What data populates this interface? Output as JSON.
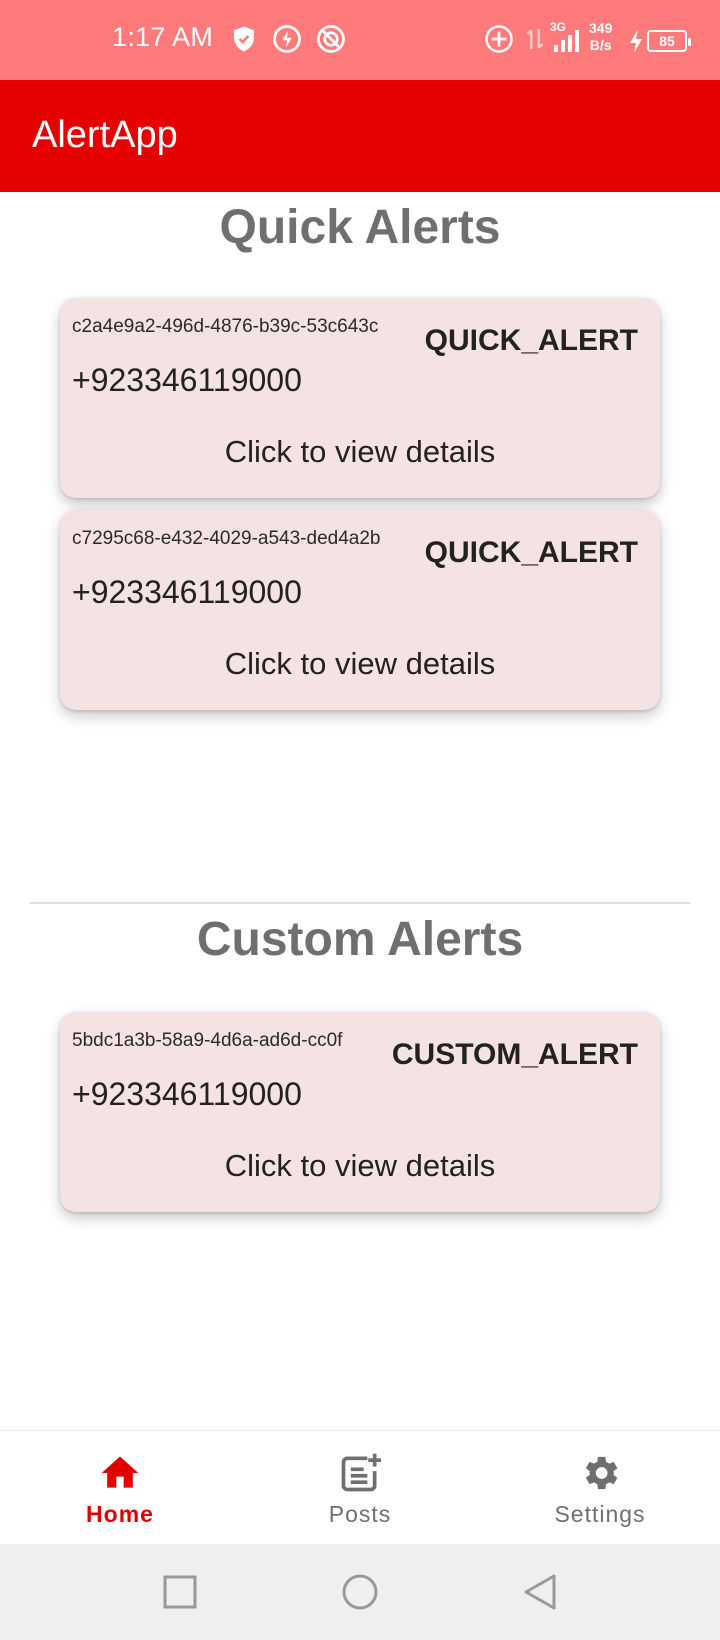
{
  "status_bar": {
    "time": "1:17 AM",
    "network_type": "3G",
    "net_speed_value": "349",
    "net_speed_unit": "B/s",
    "battery": "85",
    "icons": [
      "shield-icon",
      "flash-icon",
      "data-saver-icon",
      "add-circle-icon",
      "data-arrows-icon",
      "signal-icon",
      "charging-icon",
      "battery-icon"
    ]
  },
  "app_bar": {
    "title": "AlertApp"
  },
  "quick_alerts": {
    "title": "Quick Alerts",
    "items": [
      {
        "id": "c2a4e9a2-496d-4876-b39c-53c643c",
        "type": "QUICK_ALERT",
        "phone": "+923346119000",
        "action": "Click to view details"
      },
      {
        "id": "c7295c68-e432-4029-a543-ded4a2b",
        "type": "QUICK_ALERT",
        "phone": "+923346119000",
        "action": "Click to view details"
      }
    ]
  },
  "custom_alerts": {
    "title": "Custom Alerts",
    "items": [
      {
        "id": "5bdc1a3b-58a9-4d6a-ad6d-cc0f",
        "type": "CUSTOM_ALERT",
        "phone": "+923346119000",
        "action": "Click to view details"
      }
    ]
  },
  "bottom_nav": {
    "items": [
      {
        "label": "Home",
        "icon": "home-icon",
        "active": true
      },
      {
        "label": "Posts",
        "icon": "post-add-icon",
        "active": false
      },
      {
        "label": "Settings",
        "icon": "gear-icon",
        "active": false
      }
    ]
  },
  "colors": {
    "status_bar": "#ff7a7a",
    "app_bar": "#e60000",
    "card_background": "#f5e3e3",
    "active_nav": "#e00000",
    "section_title": "#6f6f6f"
  }
}
